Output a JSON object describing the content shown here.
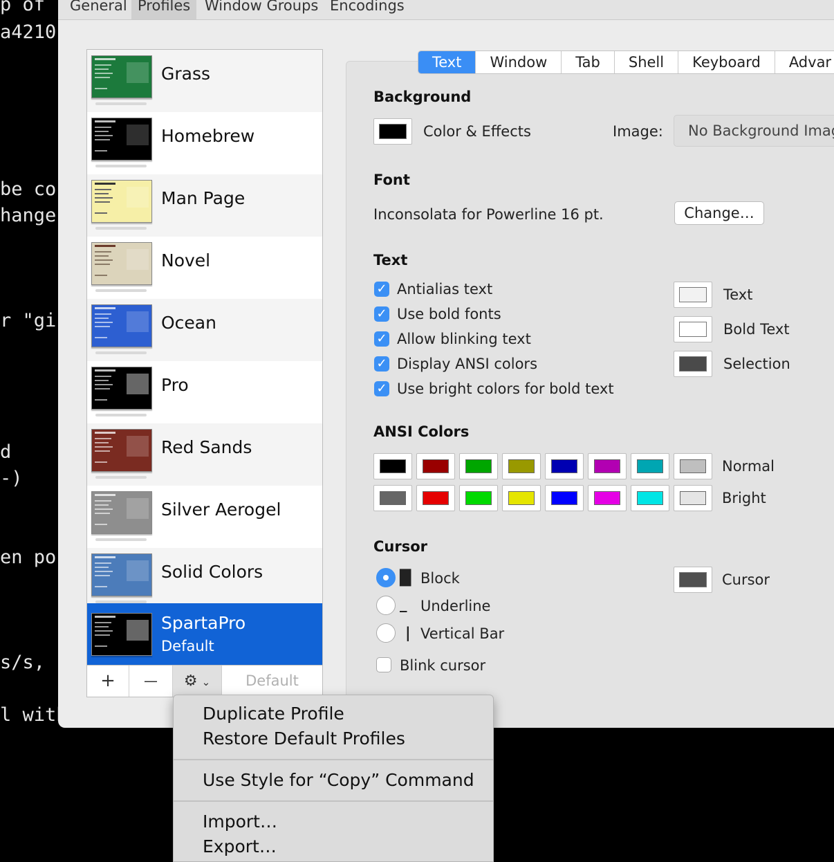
{
  "terminal_fragments": [
    "p of",
    "a4210",
    "be co",
    "hange",
    "r \"gi",
    "d",
    "-)",
    "en po",
    "s/s,",
    "l with"
  ],
  "toolbar": {
    "items": [
      "General",
      "Profiles",
      "Window Groups",
      "Encodings"
    ]
  },
  "profiles": [
    {
      "name": "Grass",
      "color": "#1c7a3c"
    },
    {
      "name": "Homebrew",
      "color": "#000000"
    },
    {
      "name": "Man Page",
      "color": "#f6efa7"
    },
    {
      "name": "Novel",
      "color": "#dcd4bb"
    },
    {
      "name": "Ocean",
      "color": "#2d5fd1"
    },
    {
      "name": "Pro",
      "color": "#000000"
    },
    {
      "name": "Red Sands",
      "color": "#7a2b21"
    },
    {
      "name": "Silver Aerogel",
      "color": "#8e8e8e"
    },
    {
      "name": "Solid Colors",
      "color": "#4c7cba"
    },
    {
      "name": "SpartaPro",
      "subtitle": "Default",
      "color": "#000000",
      "selected": true
    }
  ],
  "list_bar": {
    "add": "+",
    "remove": "—",
    "gear": "⚙",
    "default": "Default"
  },
  "tabs": [
    "Text",
    "Window",
    "Tab",
    "Shell",
    "Keyboard",
    "Advar"
  ],
  "background": {
    "title": "Background",
    "color_effects": "Color & Effects",
    "image_label": "Image:",
    "image_value": "No Background Imag"
  },
  "font": {
    "title": "Font",
    "value": "Inconsolata for Powerline 16 pt.",
    "change": "Change…"
  },
  "text": {
    "title": "Text",
    "checkboxes": [
      "Antialias text",
      "Use bold fonts",
      "Allow blinking text",
      "Display ANSI colors",
      "Use bright colors for bold text"
    ],
    "wells": [
      {
        "label": "Text",
        "color": "#f2f2f2"
      },
      {
        "label": "Bold Text",
        "color": "#ffffff"
      },
      {
        "label": "Selection",
        "color": "#4a4a4a"
      }
    ]
  },
  "ansi": {
    "title": "ANSI Colors",
    "normal_label": "Normal",
    "bright_label": "Bright",
    "normal": [
      "#000000",
      "#990000",
      "#00a600",
      "#999900",
      "#0000b2",
      "#b200b2",
      "#00a6b2",
      "#bfbfbf"
    ],
    "bright": [
      "#666666",
      "#e50000",
      "#00d900",
      "#e5e500",
      "#0000ff",
      "#e500e5",
      "#00e5e5",
      "#e5e5e5"
    ]
  },
  "cursor": {
    "title": "Cursor",
    "options": [
      {
        "glyph": "█",
        "label": "Block",
        "selected": true
      },
      {
        "glyph": "_",
        "label": "Underline"
      },
      {
        "glyph": "|",
        "label": "Vertical Bar"
      }
    ],
    "blink": "Blink cursor",
    "color_label": "Cursor",
    "color": "#505050"
  },
  "menu": {
    "items": [
      "Duplicate Profile",
      "Restore Default Profiles",
      "Use Style for “Copy” Command",
      "Import…",
      "Export…"
    ]
  }
}
